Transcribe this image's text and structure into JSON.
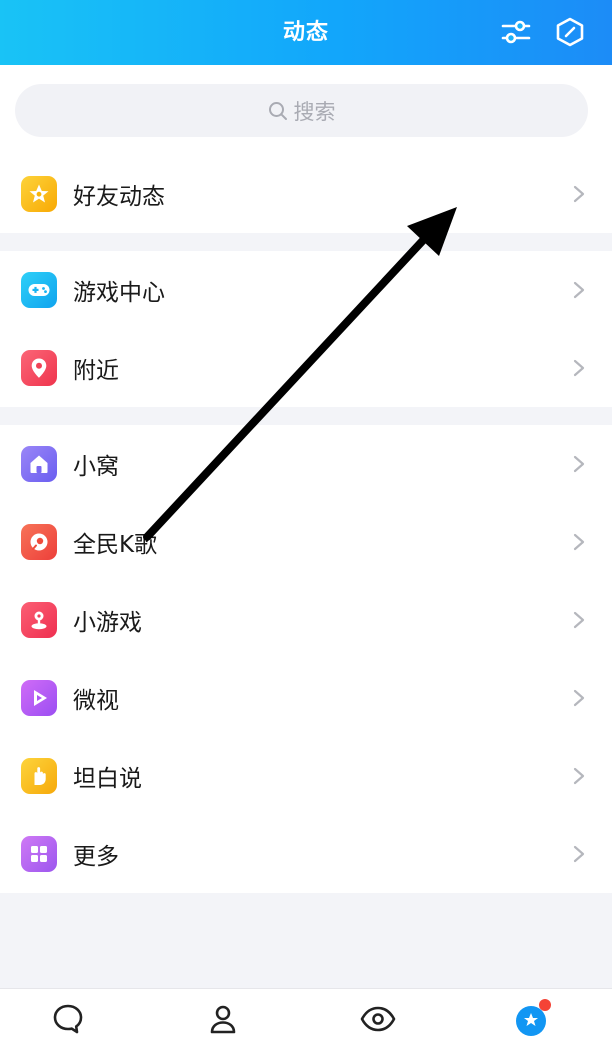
{
  "header": {
    "title": "动态"
  },
  "search": {
    "placeholder": "搜索"
  },
  "groups": [
    [
      {
        "label": "好友动态",
        "icon": "star-icon",
        "color": "#fbb80a"
      }
    ],
    [
      {
        "label": "游戏中心",
        "icon": "gamepad-icon",
        "color": "#17b8f3"
      },
      {
        "label": "附近",
        "icon": "location-pin-icon",
        "color": "#f2465a"
      }
    ],
    [
      {
        "label": "小窝",
        "icon": "home-icon",
        "color": "#7b6cf3"
      },
      {
        "label": "全民K歌",
        "icon": "karaoke-icon",
        "color": "#f1543f"
      },
      {
        "label": "小游戏",
        "icon": "joystick-icon",
        "color": "#f23c5c"
      },
      {
        "label": "微视",
        "icon": "play-icon",
        "color": "#b35af4"
      },
      {
        "label": "坦白说",
        "icon": "hand-icon",
        "color": "#f8b90d"
      },
      {
        "label": "更多",
        "icon": "grid-icon",
        "color": "#b069f0"
      }
    ]
  ],
  "tabbar": {
    "tabs": [
      {
        "name": "messages",
        "icon": "chat-bubble-icon"
      },
      {
        "name": "contacts",
        "icon": "person-icon"
      },
      {
        "name": "watch",
        "icon": "eye-icon"
      },
      {
        "name": "dynamics",
        "icon": "star-planet-icon",
        "badge": true
      }
    ]
  },
  "colors": {
    "header_start": "#19c3f6",
    "header_end": "#1c8cf7",
    "badge": "#f44336"
  }
}
